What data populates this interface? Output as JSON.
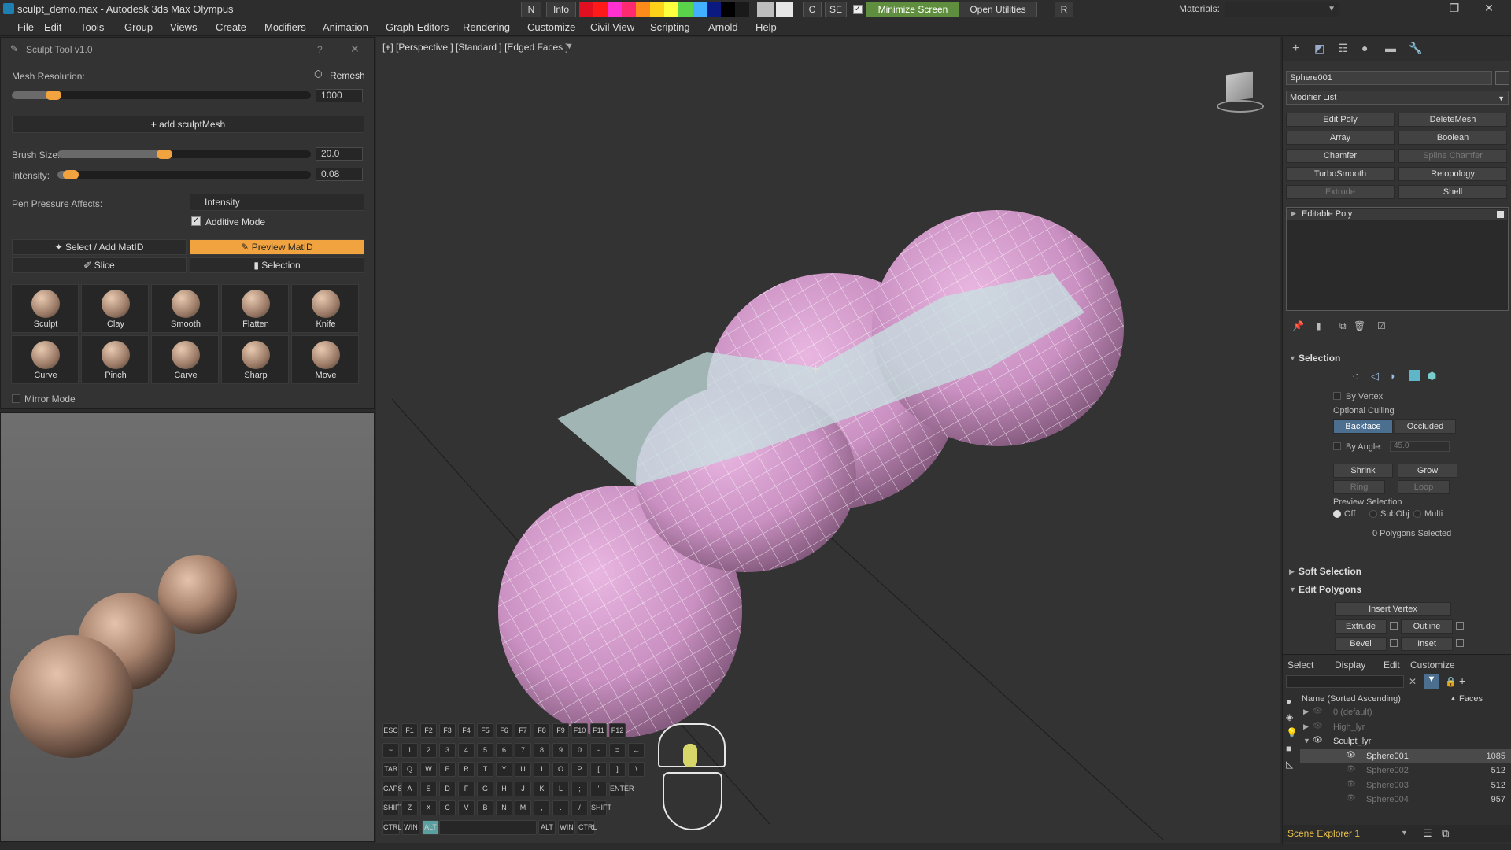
{
  "titlebar": {
    "title": "sculpt_demo.max - Autodesk 3ds Max Olympus",
    "btn_n": "N",
    "btn_info": "Info",
    "btn_c": "C",
    "btn_se": "SE",
    "minimize_screen": "Minimize Screen",
    "open_utilities": "Open Utilities",
    "btn_r": "R",
    "materials_label": "Materials:",
    "colors": [
      "#e01020",
      "#ff1a1a",
      "#ff30d0",
      "#ff2a70",
      "#ff8c1a",
      "#ffd21a",
      "#ffff40",
      "#5ad34a",
      "#40b0ff",
      "#0a1a80",
      "#000000",
      "#1a1a1a"
    ]
  },
  "menubar": {
    "items": [
      "File",
      "Edit",
      "Tools",
      "Group",
      "Views",
      "Create",
      "Modifiers",
      "Animation",
      "Graph Editors",
      "Rendering",
      "Customize",
      "Civil View",
      "Scripting",
      "Arnold",
      "Help"
    ]
  },
  "sculpt_tool": {
    "title": "Sculpt Tool v1.0",
    "help": "?",
    "mesh_resolution_label": "Mesh Resolution:",
    "remesh": "Remesh",
    "mesh_resolution_value": "1000",
    "add_sculptmesh": "add sculptMesh",
    "brush_size_label": "Brush Size:",
    "brush_size_value": "20.0",
    "intensity_label": "Intensity:",
    "intensity_value": "0.08",
    "pen_pressure_label": "Pen Pressure Affects:",
    "pen_pressure_value": "Intensity",
    "additive_mode": "Additive Mode",
    "select_add_matid": "Select / Add MatID",
    "preview_matid": "Preview MatID",
    "slice": "Slice",
    "selection": "Selection",
    "tools": [
      "Sculpt",
      "Clay",
      "Smooth",
      "Flatten",
      "Knife",
      "Curve",
      "Pinch",
      "Carve",
      "Sharp",
      "Move"
    ],
    "mirror_mode": "Mirror Mode",
    "mesh_resolution_fraction": 0.13,
    "brush_size_fraction": 0.41,
    "intensity_fraction": 0.04
  },
  "viewport": {
    "label": "[+] [Perspective ] [Standard ] [Edged Faces ]",
    "keyboard": {
      "row1": [
        "ESC",
        "F1",
        "F2",
        "F3",
        "F4",
        "F5",
        "F6",
        "F7",
        "F8",
        "F9",
        "F10",
        "F11",
        "F12"
      ],
      "row2": [
        "~",
        "1",
        "2",
        "3",
        "4",
        "5",
        "6",
        "7",
        "8",
        "9",
        "0",
        "-",
        "=",
        "←"
      ],
      "row3": [
        "TAB",
        "Q",
        "W",
        "E",
        "R",
        "T",
        "Y",
        "U",
        "I",
        "O",
        "P",
        "[",
        "]",
        "\\"
      ],
      "row4": [
        "CAPS",
        "A",
        "S",
        "D",
        "F",
        "G",
        "H",
        "J",
        "K",
        "L",
        ";",
        "'",
        "ENTER"
      ],
      "row5": [
        "SHIFT",
        "Z",
        "X",
        "C",
        "V",
        "B",
        "N",
        "M",
        ",",
        ".",
        "/",
        "SHIFT"
      ],
      "row6": [
        "CTRL",
        "WIN",
        "ALT",
        "ALT",
        "WIN",
        "CTRL"
      ]
    }
  },
  "command_panel": {
    "object_name": "Sphere001",
    "modifier_list": "Modifier List",
    "modifier_buttons": [
      {
        "label": "Edit Poly",
        "dim": false
      },
      {
        "label": "DeleteMesh",
        "dim": false
      },
      {
        "label": "Array",
        "dim": false
      },
      {
        "label": "Boolean",
        "dim": false
      },
      {
        "label": "Chamfer",
        "dim": false
      },
      {
        "label": "Spline Chamfer",
        "dim": true
      },
      {
        "label": "TurboSmooth",
        "dim": false
      },
      {
        "label": "Retopology",
        "dim": false
      },
      {
        "label": "Extrude",
        "dim": true
      },
      {
        "label": "Shell",
        "dim": false
      }
    ],
    "stack_item": "Editable Poly",
    "selection_title": "Selection",
    "by_vertex": "By Vertex",
    "optional_culling": "Optional Culling",
    "backface": "Backface",
    "occluded": "Occluded",
    "by_angle": "By Angle:",
    "by_angle_value": "45.0",
    "shrink": "Shrink",
    "grow": "Grow",
    "ring": "Ring",
    "loop": "Loop",
    "preview_selection": "Preview Selection",
    "off": "Off",
    "subobj": "SubObj",
    "multi": "Multi",
    "polygons_selected": "0 Polygons Selected",
    "soft_selection": "Soft Selection",
    "edit_polygons": "Edit Polygons",
    "insert_vertex": "Insert Vertex",
    "extrude": "Extrude",
    "outline": "Outline",
    "bevel": "Bevel",
    "inset": "Inset"
  },
  "scene_explorer": {
    "tabs": [
      "Select",
      "Display",
      "Edit",
      "Customize"
    ],
    "col_name": "Name (Sorted Ascending)",
    "col_faces": "Faces",
    "rows": [
      {
        "name": "0 (default)",
        "faces": "",
        "dim": true,
        "child": false
      },
      {
        "name": "High_lyr",
        "faces": "",
        "dim": true,
        "child": false
      },
      {
        "name": "Sculpt_lyr",
        "faces": "",
        "dim": false,
        "child": false
      },
      {
        "name": "Sphere001",
        "faces": "1085",
        "dim": false,
        "child": true
      },
      {
        "name": "Sphere002",
        "faces": "512",
        "dim": true,
        "child": true
      },
      {
        "name": "Sphere003",
        "faces": "512",
        "dim": true,
        "child": true
      },
      {
        "name": "Sphere004",
        "faces": "957",
        "dim": true,
        "child": true
      }
    ],
    "footer": "Scene Explorer 1"
  }
}
